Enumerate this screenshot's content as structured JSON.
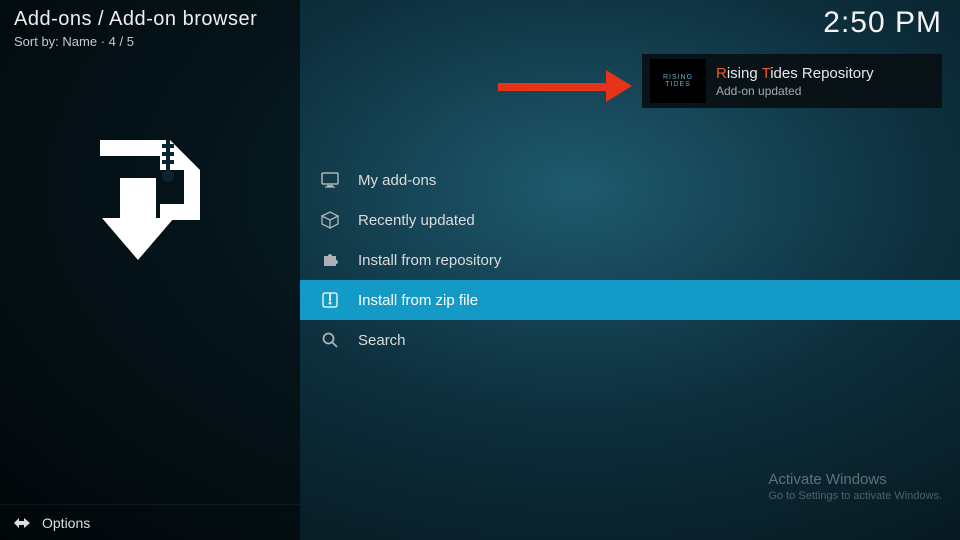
{
  "header": {
    "title": "Add-ons / Add-on browser",
    "subtitle": "Sort by: Name  ·  4 / 5"
  },
  "clock": "2:50 PM",
  "menu": {
    "items": [
      {
        "label": "My add-ons",
        "icon": "monitor-icon",
        "selected": false
      },
      {
        "label": "Recently updated",
        "icon": "box-icon",
        "selected": false
      },
      {
        "label": "Install from repository",
        "icon": "puzzle-icon",
        "selected": false
      },
      {
        "label": "Install from zip file",
        "icon": "zip-icon",
        "selected": true
      },
      {
        "label": "Search",
        "icon": "search-icon",
        "selected": false
      }
    ]
  },
  "notification": {
    "title_segments": [
      "R",
      "ising ",
      "T",
      "ides ",
      "Repository"
    ],
    "subtitle": "Add-on updated",
    "thumb_text": "RISING TIDES"
  },
  "options": {
    "label": "Options"
  },
  "watermark": {
    "line1": "Activate Windows",
    "line2": "Go to Settings to activate Windows."
  }
}
